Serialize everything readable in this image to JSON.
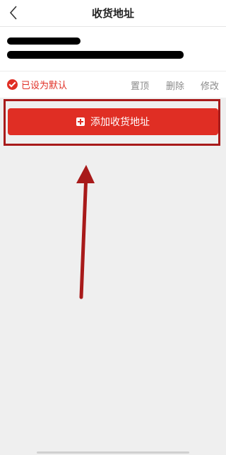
{
  "header": {
    "title": "收货地址",
    "back_icon": "chevron-left-icon"
  },
  "address": {
    "is_default_label": "已设为默认",
    "actions": {
      "pin": "置顶",
      "delete": "删除",
      "edit": "修改"
    }
  },
  "add_button": {
    "label": "添加收货地址",
    "icon": "plus-square-icon"
  },
  "annotation": {
    "color": "#a81a1a"
  },
  "colors": {
    "accent": "#e02e24",
    "muted": "#8a8a8a",
    "background": "#efefef"
  }
}
